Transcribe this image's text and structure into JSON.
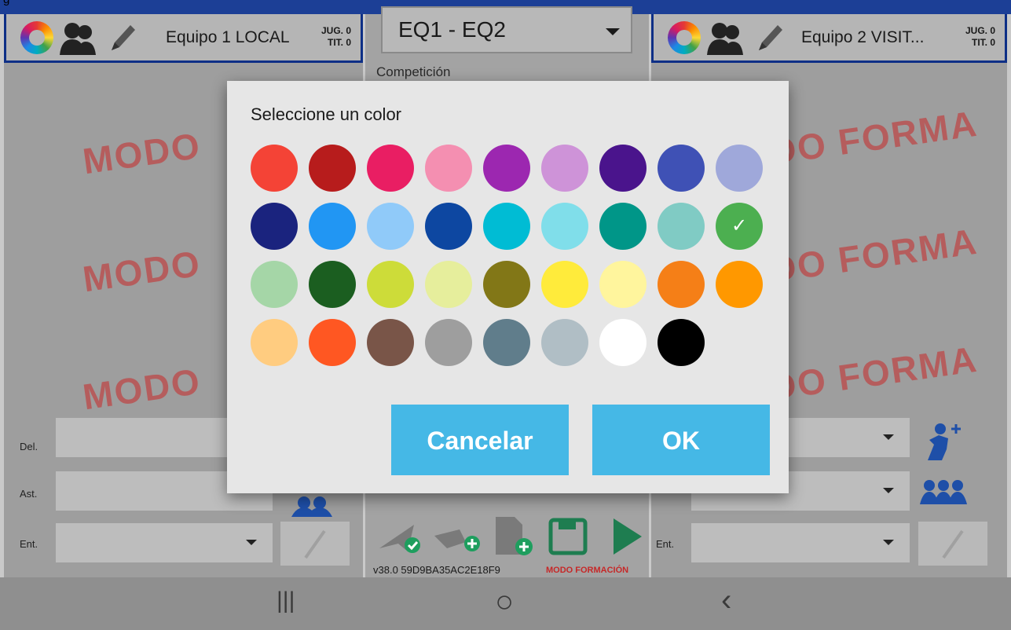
{
  "top_strip_text": "g",
  "left_team": {
    "name": "Equipo 1 LOCAL",
    "jug": "JUG. 0",
    "tit": "TIT. 0"
  },
  "right_team": {
    "name": "Equipo 2 VISIT...",
    "jug": "JUG. 0",
    "tit": "TIT. 0"
  },
  "match": {
    "title": "EQ1 - EQ2",
    "competition_label": "Competición"
  },
  "watermark_left": "MODO",
  "watermark_right": "DO FORMA",
  "fields": {
    "del": "Del.",
    "ast": "Ast.",
    "ent": "Ent."
  },
  "footer": {
    "version": "v38.0  59D9BA35AC2E18F9",
    "mode": "MODO FORMACIÓN"
  },
  "dialog": {
    "title": "Seleccione un color",
    "cancel": "Cancelar",
    "ok": "OK",
    "selected_index": 17,
    "check_mark": "✓",
    "colors": [
      "#F44336",
      "#B71C1C",
      "#E91E63",
      "#F48FB1",
      "#9C27B0",
      "#CE93D8",
      "#4A148C",
      "#3F51B5",
      "#9FA8DA",
      "#1A237E",
      "#2196F3",
      "#90CAF9",
      "#0D47A1",
      "#00BCD4",
      "#80DEEA",
      "#009688",
      "#80CBC4",
      "#4CAF50",
      "#A5D6A7",
      "#1B5E20",
      "#CDDC39",
      "#E6EE9C",
      "#827717",
      "#FFEB3B",
      "#FFF59D",
      "#F57F17",
      "#FF9800",
      "#FFCC80",
      "#FF5722",
      "#795548",
      "#9E9E9E",
      "#607D8B",
      "#B0BEC5",
      "#FFFFFF",
      "#000000"
    ]
  },
  "nav": {
    "recents": "|||",
    "home": "○",
    "back": "‹"
  }
}
